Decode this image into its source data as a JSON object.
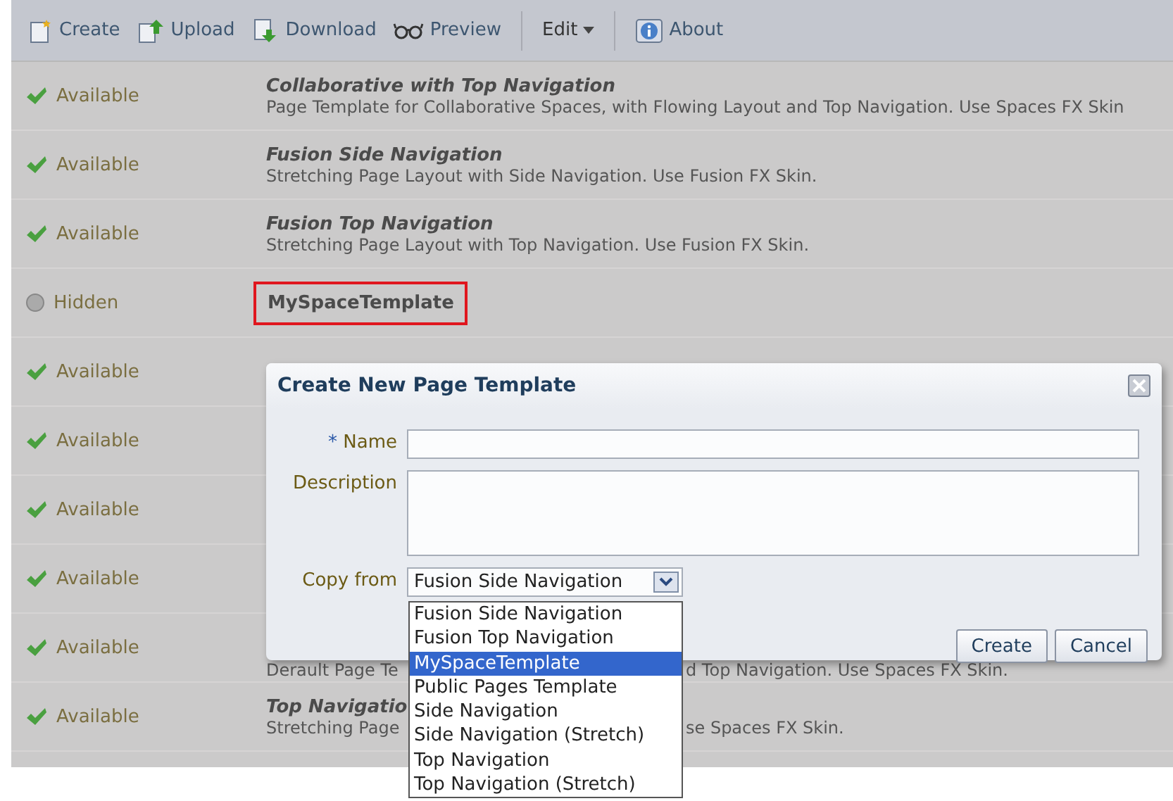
{
  "toolbar": {
    "groups": [
      [
        {
          "kind": "create",
          "label": "Create"
        },
        {
          "kind": "upload",
          "label": "Upload"
        },
        {
          "kind": "download",
          "label": "Download"
        },
        {
          "kind": "preview",
          "label": "Preview"
        }
      ],
      [
        {
          "kind": "menu",
          "label": "Edit"
        }
      ],
      [
        {
          "kind": "about",
          "label": "About"
        }
      ]
    ]
  },
  "rows": [
    {
      "kind": "available",
      "status_label": "Available",
      "title": "Collaborative with Top Navigation",
      "description": "Page Template for Collaborative Spaces, with Flowing Layout and Top Navigation. Use Spaces FX Skin",
      "highlighted": false
    },
    {
      "kind": "available",
      "status_label": "Available",
      "title": "Fusion Side Navigation",
      "description": "Stretching Page Layout with Side Navigation. Use Fusion FX Skin.",
      "highlighted": false
    },
    {
      "kind": "available",
      "status_label": "Available",
      "title": "Fusion Top Navigation",
      "description": "Stretching Page Layout with Top Navigation. Use Fusion FX Skin.",
      "highlighted": false
    },
    {
      "kind": "hidden",
      "status_label": "Hidden",
      "title": "MySpaceTemplate",
      "highlighted": true
    },
    {
      "kind": "available",
      "status_label": "Available"
    },
    {
      "kind": "available",
      "status_label": "Available"
    },
    {
      "kind": "available",
      "status_label": "Available"
    },
    {
      "kind": "available",
      "status_label": "Available"
    },
    {
      "kind": "available",
      "status_label": "Available",
      "description": "Derault Page Te",
      "description_tail": "d Top Navigation. Use Spaces FX Skin.",
      "highlighted": false
    },
    {
      "kind": "available",
      "status_label": "Available",
      "title": "Top Navigatio",
      "description": "Stretching Page",
      "description_tail": "se Spaces FX Skin.",
      "highlighted": false
    }
  ],
  "dialog": {
    "title": "Create New Page Template",
    "fields": [
      {
        "kind": "text",
        "label": "Name",
        "required_mark": "*"
      },
      {
        "kind": "textarea",
        "label": "Description"
      },
      {
        "kind": "select",
        "label": "Copy from",
        "value": "Fusion Side Navigation"
      }
    ],
    "dropdown_options": [
      {
        "label": "Fusion Side Navigation",
        "selected": false
      },
      {
        "label": "Fusion Top Navigation",
        "selected": false
      },
      {
        "label": "MySpaceTemplate",
        "selected": true
      },
      {
        "label": "Public Pages Template",
        "selected": false
      },
      {
        "label": "Side Navigation",
        "selected": false
      },
      {
        "label": "Side Navigation (Stretch)",
        "selected": false
      },
      {
        "label": "Top Navigation",
        "selected": false
      },
      {
        "label": "Top Navigation (Stretch)",
        "selected": false
      }
    ],
    "buttons": [
      "Create",
      "Cancel"
    ]
  }
}
